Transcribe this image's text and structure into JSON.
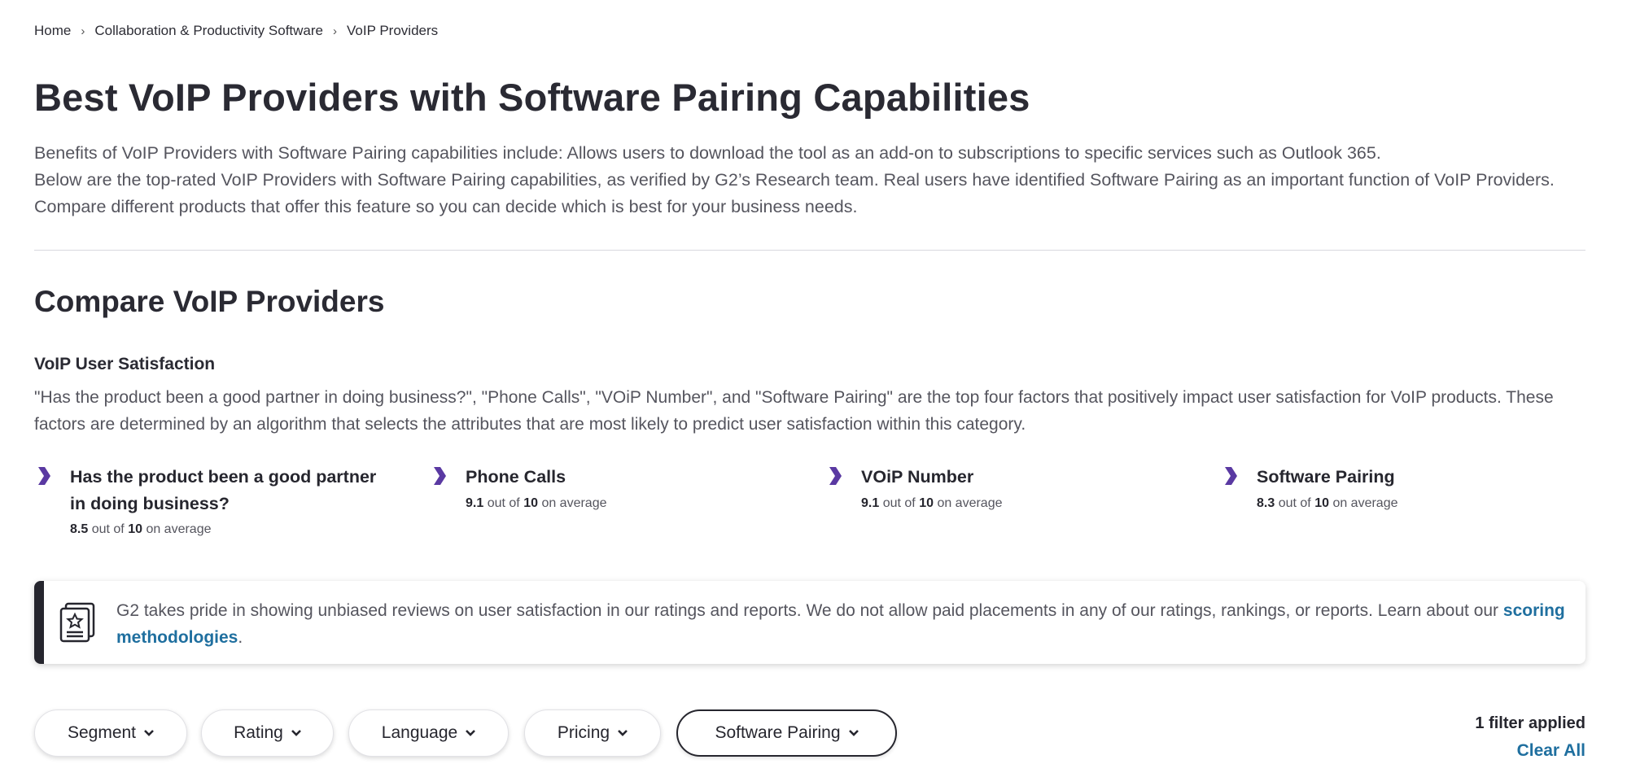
{
  "breadcrumb": {
    "items": [
      "Home",
      "Collaboration & Productivity Software",
      "VoIP Providers"
    ],
    "separator": "›"
  },
  "page_title": "Best VoIP Providers with Software Pairing Capabilities",
  "intro": {
    "line1": "Benefits of VoIP Providers with Software Pairing capabilities include: Allows users to download the tool as an add-on to subscriptions to specific services such as Outlook 365.",
    "line2": "Below are the top-rated VoIP Providers with Software Pairing capabilities, as verified by G2’s Research team. Real users have identified Software Pairing as an important function of VoIP Providers. Compare different products that offer this feature so you can decide which is best for your business needs."
  },
  "compare_title": "Compare VoIP Providers",
  "satisfaction": {
    "title": "VoIP User Satisfaction",
    "description": "\"Has the product been a good partner in doing business?\", \"Phone Calls\", \"VOiP Number\", and \"Software Pairing\" are the top four factors that positively impact user satisfaction for VoIP products. These factors are determined by an algorithm that selects the attributes that are most likely to predict user satisfaction within this category.",
    "factors": [
      {
        "name": "Has the product been a good partner in doing business?",
        "score": "8.5",
        "of": "out of",
        "max": "10",
        "suffix": "on average"
      },
      {
        "name": "Phone Calls",
        "score": "9.1",
        "of": "out of",
        "max": "10",
        "suffix": "on average"
      },
      {
        "name": "VOiP Number",
        "score": "9.1",
        "of": "out of",
        "max": "10",
        "suffix": "on average"
      },
      {
        "name": "Software Pairing",
        "score": "8.3",
        "of": "out of",
        "max": "10",
        "suffix": "on average"
      }
    ]
  },
  "notice": {
    "text": "G2 takes pride in showing unbiased reviews on user satisfaction in our ratings and reports. We do not allow paid placements in any of our ratings, rankings, or reports. Learn about our ",
    "link": "scoring methodologies",
    "end": ".",
    "icon": "certificate-icon"
  },
  "filters": {
    "pills": [
      "Segment",
      "Rating",
      "Language",
      "Pricing",
      "Software Pairing"
    ],
    "active_pill": "Software Pairing",
    "applied": "1 filter applied",
    "clear_all": "Clear All"
  },
  "colors": {
    "accent_purple": "#5a39a2",
    "link_blue": "#1f6f9f",
    "dark_text": "#26262e",
    "body_text": "#55555e"
  }
}
